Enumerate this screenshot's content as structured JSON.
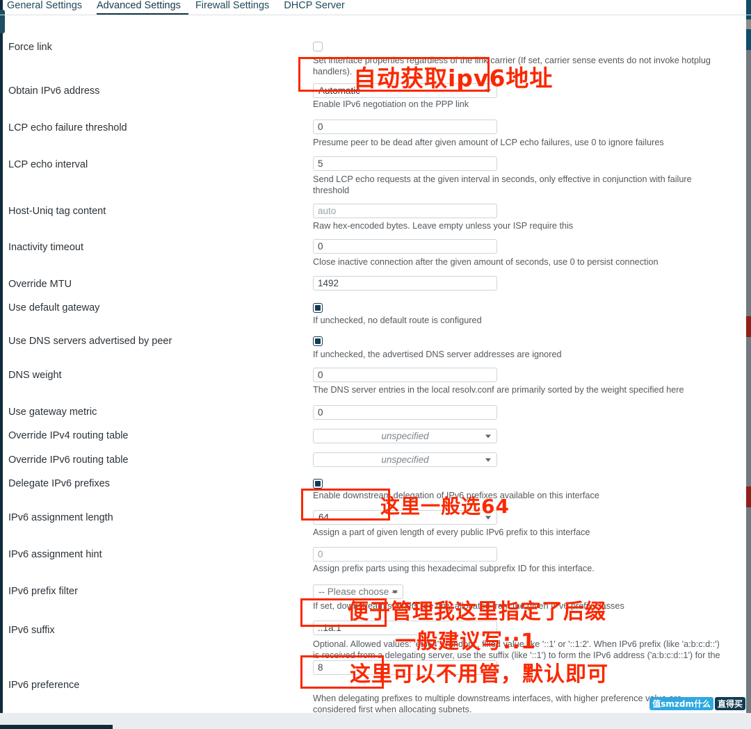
{
  "tabs": [
    {
      "label": "General Settings",
      "active": false
    },
    {
      "label": "Advanced Settings",
      "active": true
    },
    {
      "label": "Firewall Settings",
      "active": false
    },
    {
      "label": "DHCP Server",
      "active": false
    }
  ],
  "rows": [
    {
      "label": "Force link",
      "control": "checkbox",
      "checked": false,
      "help": "Set interface properties regardless of the link carrier (If set, carrier sense events do not invoke hotplug handlers)."
    },
    {
      "label": "Obtain IPv6 address",
      "control": "select",
      "value": "Automatic",
      "help": "Enable IPv6 negotiation on the PPP link"
    },
    {
      "label": "LCP echo failure threshold",
      "control": "text",
      "value": "0",
      "help": "Presume peer to be dead after given amount of LCP echo failures, use 0 to ignore failures"
    },
    {
      "label": "LCP echo interval",
      "control": "text",
      "value": "5",
      "help": "Send LCP echo requests at the given interval in seconds, only effective in conjunction with failure threshold"
    },
    {
      "label": "Host-Uniq tag content",
      "control": "text",
      "value": "",
      "placeholder": "auto",
      "help": "Raw hex-encoded bytes. Leave empty unless your ISP require this"
    },
    {
      "label": "Inactivity timeout",
      "control": "text",
      "value": "0",
      "help": "Close inactive connection after the given amount of seconds, use 0 to persist connection"
    },
    {
      "label": "Override MTU",
      "control": "text",
      "value": "1492",
      "help": ""
    },
    {
      "label": "Use default gateway",
      "control": "checkbox",
      "checked": true,
      "help": "If unchecked, no default route is configured"
    },
    {
      "label": "Use DNS servers advertised by peer",
      "control": "checkbox",
      "checked": true,
      "help": "If unchecked, the advertised DNS server addresses are ignored"
    },
    {
      "label": "DNS weight",
      "control": "text",
      "value": "0",
      "help": "The DNS server entries in the local resolv.conf are primarily sorted by the weight specified here"
    },
    {
      "label": "Use gateway metric",
      "control": "text",
      "value": "0",
      "help": ""
    },
    {
      "label": "Override IPv4 routing table",
      "control": "select-italic",
      "value": "unspecified",
      "help": ""
    },
    {
      "label": "Override IPv6 routing table",
      "control": "select-italic",
      "value": "unspecified",
      "help": ""
    },
    {
      "label": "Delegate IPv6 prefixes",
      "control": "checkbox",
      "checked": true,
      "help": "Enable downstream delegation of IPv6 prefixes available on this interface"
    },
    {
      "label": "IPv6 assignment length",
      "control": "select",
      "value": "64",
      "help": "Assign a part of given length of every public IPv6 prefix to this interface"
    },
    {
      "label": "IPv6 assignment hint",
      "control": "text",
      "value": "",
      "placeholder": "0",
      "help": "Assign prefix parts using this hexadecimal subprefix ID for this interface."
    },
    {
      "label": "IPv6 prefix filter",
      "control": "select-small",
      "value": "-- Please choose --",
      "help": "If set, downstream subnets are only allocated from the given IPv6 prefix classes"
    },
    {
      "label": "IPv6 suffix",
      "control": "text",
      "value": "::1a:1",
      "help": "Optional. Allowed values: 'eui64', 'random', fixed value like '::1' or '::1:2'. When IPv6 prefix (like 'a:b:c:d::') is received from a delegating server, use the suffix (like '::1') to form the IPv6 address ('a:b:c:d::1') for the interface."
    },
    {
      "label": "IPv6 preference",
      "control": "text",
      "value": "8",
      "help": "When delegating prefixes to multiple downstreams interfaces, with higher preference value are considered first when allocating subnets."
    }
  ],
  "annotations": [
    {
      "text": "自动获取ipv6地址"
    },
    {
      "text": "这里一般选64"
    },
    {
      "text": "便于管理我这里指定了后缀"
    },
    {
      "text": "一般建议写::1"
    },
    {
      "text": "这里可以不用管，默认即可"
    }
  ],
  "watermark": {
    "left": "值smzdm什么",
    "right": "直得买"
  },
  "colors": {
    "annotation_red": "#fa2800",
    "tab_active": "#16384a",
    "checkbox_on": "#123c53"
  }
}
